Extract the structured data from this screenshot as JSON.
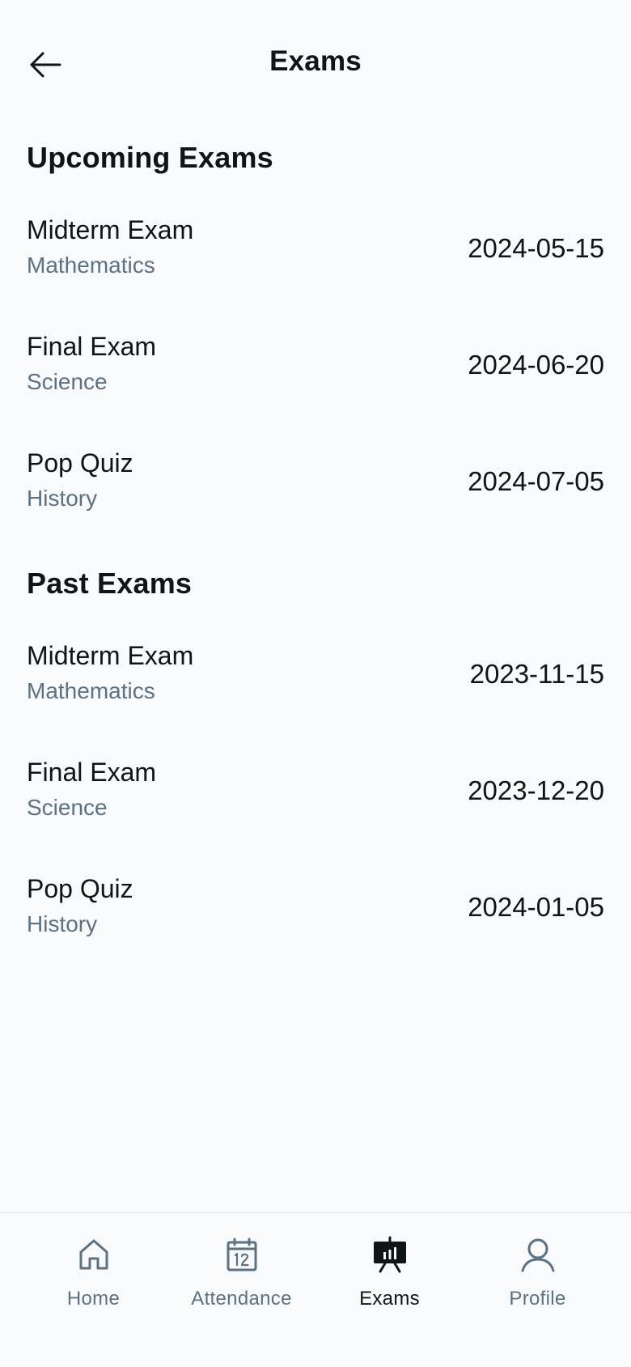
{
  "header": {
    "title": "Exams",
    "back_icon": "arrow-left-icon"
  },
  "upcoming": {
    "title": "Upcoming Exams",
    "items": [
      {
        "name": "Midterm Exam",
        "subject": "Mathematics",
        "date": "2024-05-15"
      },
      {
        "name": "Final Exam",
        "subject": "Science",
        "date": "2024-06-20"
      },
      {
        "name": "Pop Quiz",
        "subject": "History",
        "date": "2024-07-05"
      }
    ]
  },
  "past": {
    "title": "Past Exams",
    "items": [
      {
        "name": "Midterm Exam",
        "subject": "Mathematics",
        "date": "2023-11-15"
      },
      {
        "name": "Final Exam",
        "subject": "Science",
        "date": "2023-12-20"
      },
      {
        "name": "Pop Quiz",
        "subject": "History",
        "date": "2024-01-05"
      }
    ]
  },
  "nav": {
    "active": "Exams",
    "items": [
      {
        "label": "Home",
        "icon": "home-icon"
      },
      {
        "label": "Attendance",
        "icon": "calendar-icon"
      },
      {
        "label": "Exams",
        "icon": "presentation-chart-icon"
      },
      {
        "label": "Profile",
        "icon": "user-icon"
      }
    ]
  },
  "colors": {
    "background": "#f8fafc",
    "text_primary": "#0f1417",
    "text_secondary": "#5b7285",
    "divider": "#e5e8eb"
  }
}
